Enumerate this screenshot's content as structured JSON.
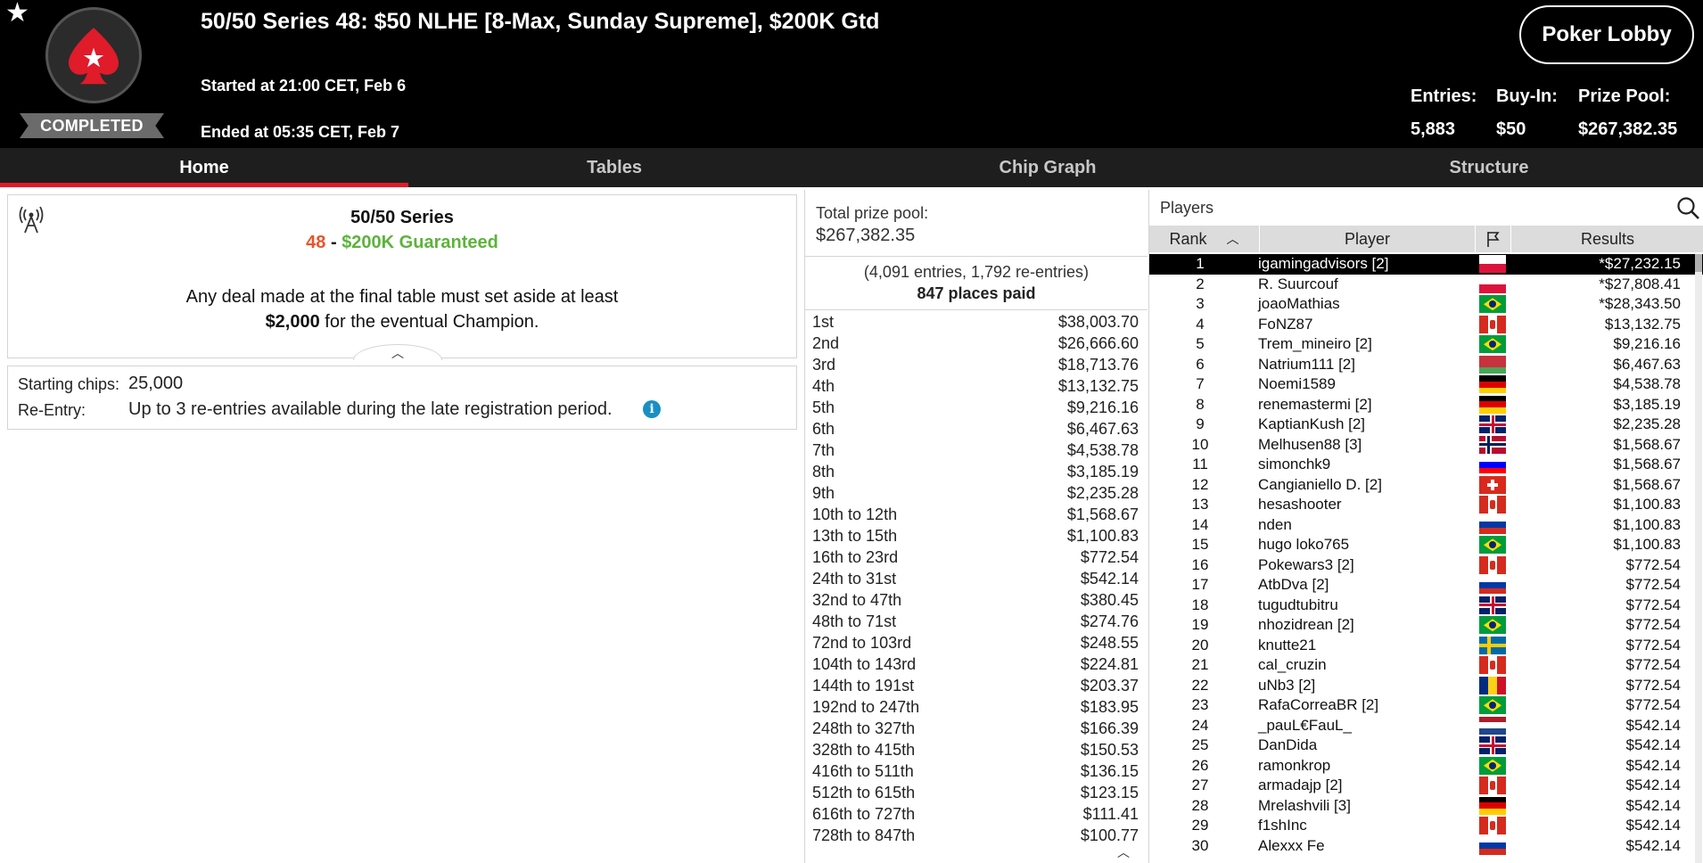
{
  "header": {
    "title": "50/50 Series 48: $50 NLHE [8-Max, Sunday Supreme], $200K Gtd",
    "started": "Started at 21:00 CET, Feb 6",
    "ended": "Ended at 05:35 CET, Feb 7",
    "status": "COMPLETED",
    "lobby_button": "Poker Lobby",
    "stats": {
      "entries_label": "Entries:",
      "entries_value": "5,883",
      "buyin_label": "Buy-In:",
      "buyin_value": "$50",
      "prizepool_label": "Prize Pool:",
      "prizepool_value": "$267,382.35"
    },
    "icons": {
      "favorite": "star-icon",
      "logo": "pokerstars-spade-logo"
    }
  },
  "tabs": [
    {
      "label": "Home",
      "active": true
    },
    {
      "label": "Tables",
      "active": false
    },
    {
      "label": "Chip Graph",
      "active": false
    },
    {
      "label": "Structure",
      "active": false
    }
  ],
  "info": {
    "series_name": "50/50 Series",
    "series_number": "48",
    "series_dash": " - ",
    "guarantee": "$200K Guaranteed",
    "deal_line1": "Any deal made at the final table must set aside at least",
    "deal_amount": "$2,000",
    "deal_line2_rest": " for the eventual Champion.",
    "collapse_icon": "chevron-up-icon"
  },
  "details": {
    "starting_chips_label": "Starting chips:",
    "starting_chips_value": "25,000",
    "reentry_label": "Re-Entry:",
    "reentry_value": "Up to 3 re-entries available during the late registration period.",
    "info_icon": "i"
  },
  "prizes": {
    "total_label": "Total prize pool:",
    "total_value": "$267,382.35",
    "entries_text": "(4,091 entries, 1,792 re-entries)",
    "places_paid": "847 places paid",
    "payouts": [
      {
        "place": "1st",
        "amount": "$38,003.70"
      },
      {
        "place": "2nd",
        "amount": "$26,666.60"
      },
      {
        "place": "3rd",
        "amount": "$18,713.76"
      },
      {
        "place": "4th",
        "amount": "$13,132.75"
      },
      {
        "place": "5th",
        "amount": "$9,216.16"
      },
      {
        "place": "6th",
        "amount": "$6,467.63"
      },
      {
        "place": "7th",
        "amount": "$4,538.78"
      },
      {
        "place": "8th",
        "amount": "$3,185.19"
      },
      {
        "place": "9th",
        "amount": "$2,235.28"
      },
      {
        "place": "10th to 12th",
        "amount": "$1,568.67"
      },
      {
        "place": "13th to 15th",
        "amount": "$1,100.83"
      },
      {
        "place": "16th to 23rd",
        "amount": "$772.54"
      },
      {
        "place": "24th to 31st",
        "amount": "$542.14"
      },
      {
        "place": "32nd to 47th",
        "amount": "$380.45"
      },
      {
        "place": "48th to 71st",
        "amount": "$274.76"
      },
      {
        "place": "72nd to 103rd",
        "amount": "$248.55"
      },
      {
        "place": "104th to 143rd",
        "amount": "$224.81"
      },
      {
        "place": "144th to 191st",
        "amount": "$203.37"
      },
      {
        "place": "192nd to 247th",
        "amount": "$183.95"
      },
      {
        "place": "248th to 327th",
        "amount": "$166.39"
      },
      {
        "place": "328th to 415th",
        "amount": "$150.53"
      },
      {
        "place": "416th to 511th",
        "amount": "$136.15"
      },
      {
        "place": "512th to 615th",
        "amount": "$123.15"
      },
      {
        "place": "616th to 727th",
        "amount": "$111.41"
      },
      {
        "place": "728th to 847th",
        "amount": "$100.77"
      }
    ]
  },
  "players": {
    "title": "Players",
    "columns": {
      "rank": "Rank",
      "player": "Player",
      "results": "Results"
    },
    "icons": {
      "search": "search-icon",
      "sort": "sort-ascending-icon",
      "flag": "flag-icon"
    },
    "rows": [
      {
        "rank": "1",
        "name": "igamingadvisors [2]",
        "flag": "PL",
        "result": "*$27,232.15",
        "selected": true
      },
      {
        "rank": "2",
        "name": "R. Suurcouf",
        "flag": "PL",
        "result": "*$27,808.41"
      },
      {
        "rank": "3",
        "name": "joaoMathias",
        "flag": "BR",
        "result": "*$28,343.50"
      },
      {
        "rank": "4",
        "name": "FoNZ87",
        "flag": "CA",
        "result": "$13,132.75"
      },
      {
        "rank": "5",
        "name": "Trem_mineiro [2]",
        "flag": "BR",
        "result": "$9,216.16"
      },
      {
        "rank": "6",
        "name": "Natrium111 [2]",
        "flag": "BY",
        "result": "$6,467.63"
      },
      {
        "rank": "7",
        "name": "Noemi1589",
        "flag": "DE",
        "result": "$4,538.78"
      },
      {
        "rank": "8",
        "name": "renemastermi [2]",
        "flag": "DE",
        "result": "$3,185.19"
      },
      {
        "rank": "9",
        "name": "KaptianKush [2]",
        "flag": "GB",
        "result": "$2,235.28"
      },
      {
        "rank": "10",
        "name": "Melhusen88 [3]",
        "flag": "NO",
        "result": "$1,568.67"
      },
      {
        "rank": "11",
        "name": "simonchk9",
        "flag": "SI",
        "result": "$1,568.67"
      },
      {
        "rank": "12",
        "name": "Cangianiello D. [2]",
        "flag": "CH",
        "result": "$1,568.67"
      },
      {
        "rank": "13",
        "name": "hesashooter",
        "flag": "CA",
        "result": "$1,100.83"
      },
      {
        "rank": "14",
        "name": "nden",
        "flag": "RU",
        "result": "$1,100.83"
      },
      {
        "rank": "15",
        "name": "hugo loko765",
        "flag": "BR",
        "result": "$1,100.83"
      },
      {
        "rank": "16",
        "name": "Pokewars3 [2]",
        "flag": "CA",
        "result": "$772.54"
      },
      {
        "rank": "17",
        "name": "AtbDva [2]",
        "flag": "RU",
        "result": "$772.54"
      },
      {
        "rank": "18",
        "name": "tugudtubitru",
        "flag": "GB",
        "result": "$772.54"
      },
      {
        "rank": "19",
        "name": "nhozidrean [2]",
        "flag": "BR",
        "result": "$772.54"
      },
      {
        "rank": "20",
        "name": "knutte21",
        "flag": "SE",
        "result": "$772.54"
      },
      {
        "rank": "21",
        "name": "cal_cruzin",
        "flag": "CA",
        "result": "$772.54"
      },
      {
        "rank": "22",
        "name": "uNb3 [2]",
        "flag": "RO",
        "result": "$772.54"
      },
      {
        "rank": "23",
        "name": "RafaCorreaBR [2]",
        "flag": "BR",
        "result": "$772.54"
      },
      {
        "rank": "24",
        "name": "_pauL€FauL_",
        "flag": "NL",
        "result": "$542.14"
      },
      {
        "rank": "25",
        "name": "DanDida",
        "flag": "GB",
        "result": "$542.14"
      },
      {
        "rank": "26",
        "name": "ramonkrop",
        "flag": "BR",
        "result": "$542.14"
      },
      {
        "rank": "27",
        "name": "armadajp [2]",
        "flag": "CA",
        "result": "$542.14"
      },
      {
        "rank": "28",
        "name": "Mrelashvili [3]",
        "flag": "DE",
        "result": "$542.14"
      },
      {
        "rank": "29",
        "name": "f1shInc",
        "flag": "CA",
        "result": "$542.14"
      },
      {
        "rank": "30",
        "name": "Alexxx Fe",
        "flag": "RU",
        "result": "$542.14"
      }
    ]
  },
  "colors": {
    "brand_red": "#e01b2a",
    "series_number": "#e8542a",
    "guarantee_green": "#5db33b",
    "info_blue": "#1a8fc4"
  }
}
